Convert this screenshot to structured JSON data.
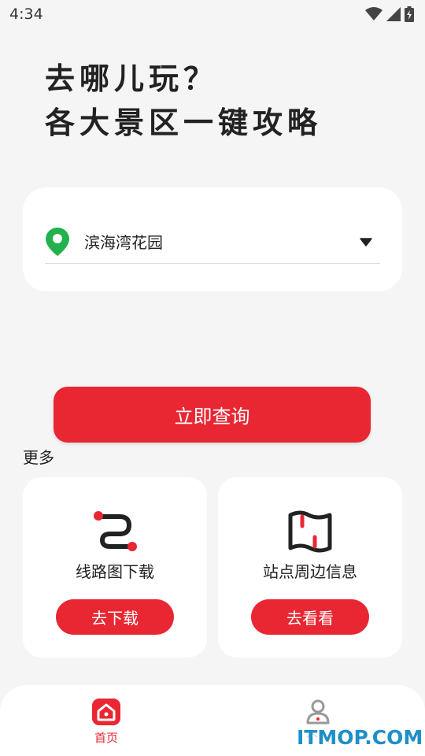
{
  "status_bar": {
    "time": "4:34"
  },
  "headline": {
    "line1": "去哪儿玩？",
    "line2": "各大景区一键攻略"
  },
  "location": {
    "selected": "滨海湾花园"
  },
  "query_button_label": "立即查询",
  "more_label": "更多",
  "features": [
    {
      "title": "线路图下载",
      "button": "去下载",
      "icon": "route-icon"
    },
    {
      "title": "站点周边信息",
      "button": "去看看",
      "icon": "map-icon"
    }
  ],
  "bottom_nav": [
    {
      "label": "首页",
      "icon": "home-icon",
      "active": true
    },
    {
      "label": "个人",
      "icon": "user-icon",
      "active": false
    }
  ],
  "watermark": "ITMOP.COM",
  "colors": {
    "accent": "#e82733",
    "pin": "#22b14c",
    "watermark": "#1e8fc7"
  }
}
